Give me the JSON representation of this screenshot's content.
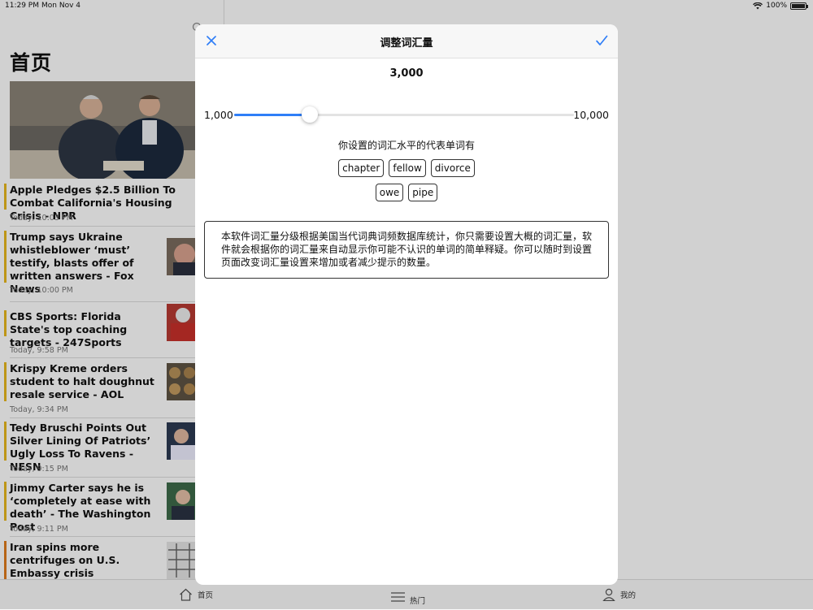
{
  "status_bar": {
    "time": "11:29 PM",
    "date": "Mon Nov 4",
    "battery": "100%"
  },
  "page_title": "首页",
  "news": [
    {
      "headline": "Apple Pledges $2.5 Billion To Combat California's Housing Crisis - NPR",
      "time": "Today, 10:03 PM"
    },
    {
      "headline": "Trump says Ukraine whistleblower ‘must’ testify, blasts offer of written answers - Fox News",
      "time": "Today, 10:00 PM"
    },
    {
      "headline": "CBS Sports: Florida State's top coaching targets - 247Sports",
      "time": "Today, 9:58 PM"
    },
    {
      "headline": "Krispy Kreme orders student to halt doughnut resale service - AOL",
      "time": "Today, 9:34 PM"
    },
    {
      "headline": "Tedy Bruschi Points Out Silver Lining Of Patriots’ Ugly Loss To Ravens - NESN",
      "time": "Today, 9:15 PM"
    },
    {
      "headline": "Jimmy Carter says he is ‘completely at ease with death’ - The Washington Post",
      "time": "Today, 9:11 PM"
    },
    {
      "headline": "Iran spins more centrifuges on U.S. Embassy crisis anniversary - NBCNews.com",
      "time": ""
    }
  ],
  "tabs": [
    {
      "label": "首页",
      "icon": "home-icon"
    },
    {
      "label": "热门",
      "icon": "list-icon"
    },
    {
      "label": "我的",
      "icon": "person-icon"
    }
  ],
  "modal": {
    "title": "调整词汇量",
    "value_label": "3,000",
    "slider": {
      "min_label": "1,000",
      "max_label": "10,000",
      "min": 1000,
      "max": 10000,
      "value": 3000
    },
    "rep_label": "你设置的词汇水平的代表单词有",
    "words_row1": [
      "chapter",
      "fellow",
      "divorce"
    ],
    "words_row2": [
      "owe",
      "pipe"
    ],
    "info": "本软件词汇量分级根据美国当代词典词频数据库统计，你只需要设置大概的词汇量，软件就会根据你的词汇量来自动显示你可能不认识的单词的简单释疑。你可以随时到设置页面改变词汇量设置来增加或者减少提示的数量。"
  },
  "colors": {
    "accent": "#2f7ef7",
    "news_accent": "#e8b81c"
  }
}
